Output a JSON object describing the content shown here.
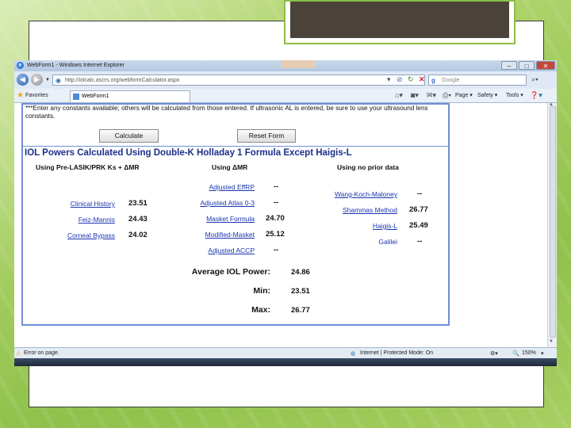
{
  "window": {
    "title": "WebForm1 - Windows Internet Explorer"
  },
  "nav": {
    "url": "http://iolcalc.ascrs.org/webformCalculator.aspx",
    "search_placeholder": "Google"
  },
  "favorites": {
    "label": "Favorites",
    "tab_title": "WebForm1"
  },
  "command_bar": {
    "page": "Page ▾",
    "safety": "Safety ▾",
    "tools": "Tools ▾"
  },
  "note": "***Enter any constants available; others will be calculated from those entered. If ultrasonic AL is entered, be sure to use your ultrasound lens constants.",
  "buttons": {
    "calculate": "Calculate",
    "reset": "Reset Form"
  },
  "section_title": "IOL Powers Calculated Using Double-K Holladay 1 Formula Except Haigis-L",
  "columns": {
    "col1": "Using Pre-LASIK/PRK Ks + ΔMR",
    "col2": "Using ΔMR",
    "col3": "Using no prior data"
  },
  "col1_rows": [
    {
      "label": "Clinical History",
      "value": "23.51"
    },
    {
      "label": "Feiz-Mannis",
      "value": "24.43"
    },
    {
      "label": "Corneal Bypass",
      "value": "24.02"
    }
  ],
  "col2_rows": [
    {
      "label": "Adjusted EffRP",
      "value": "--"
    },
    {
      "label": "Adjusted Atlas 0-3",
      "value": "--"
    },
    {
      "label": "Masket Formula",
      "value": "24.70"
    },
    {
      "label": "Modified-Masket",
      "value": "25.12"
    },
    {
      "label": "Adjusted ACCP",
      "value": "--"
    }
  ],
  "col3_rows": [
    {
      "label": "Wang-Koch-Maloney",
      "value": "--"
    },
    {
      "label": "Shammas Method",
      "value": "26.77"
    },
    {
      "label": "Haigis-L",
      "value": "25.49"
    },
    {
      "label": "Galilei",
      "value": "--"
    }
  ],
  "summary": {
    "average_label": "Average IOL Power:",
    "average_value": "24.86",
    "min_label": "Min:",
    "min_value": "23.51",
    "max_label": "Max:",
    "max_value": "26.77"
  },
  "status": {
    "left": "Error on page.",
    "zone": "Internet | Protected Mode: On",
    "zoom": "150%"
  },
  "colors": {
    "slide_green": "#a9d066",
    "link_blue": "#1b35b0",
    "title_blue": "#1b2f8a",
    "frame_blue": "#6f8fd6"
  }
}
